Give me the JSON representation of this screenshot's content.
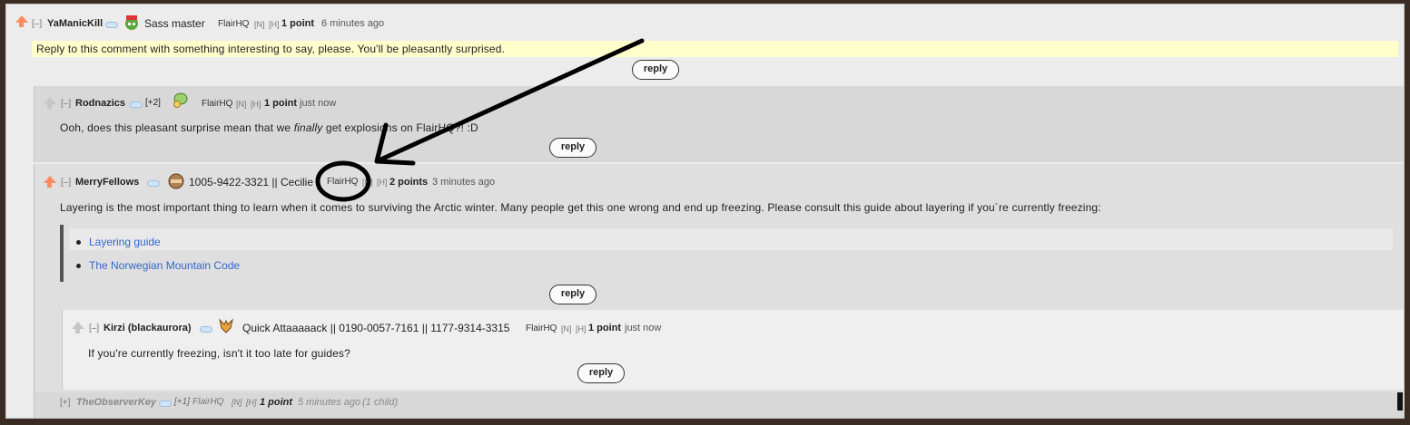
{
  "comments": {
    "c1": {
      "collapse": "[–]",
      "author": "YaManicKill",
      "flair": "Sass master",
      "tag": "FlairHQ",
      "mark_n": "[N]",
      "mark_h": "[H]",
      "points": "1 point",
      "time": "6 minutes ago",
      "body": "Reply to this comment with something interesting to say, please. You'll be pleasantly surprised.",
      "reply": "reply"
    },
    "c2": {
      "collapse": "[–]",
      "author": "Rodnazics",
      "karma": "[+2]",
      "tag": "FlairHQ",
      "mark_n": "[N]",
      "mark_h": "[H]",
      "points": "1 point",
      "time": "just now",
      "body_pre": "Ooh, does this pleasant surprise mean that we ",
      "body_em": "finally",
      "body_post": " get explosions on FlairHQ?! :D",
      "reply": "reply"
    },
    "c3": {
      "collapse": "[–]",
      "author": "MerryFellows",
      "flair": "1005-9422-3321 || Cecilie",
      "tag": "FlairHQ",
      "mark_n": "[N]",
      "mark_h": "[H]",
      "points": "2 points",
      "time": "3 minutes ago",
      "body": "Layering is the most important thing to learn when it comes to surviving the Arctic winter. Many people get this one wrong and end up freezing. Please consult this guide about layering if you´re currently freezing:",
      "links": [
        "Layering guide",
        "The Norwegian Mountain Code"
      ],
      "reply": "reply"
    },
    "c4": {
      "collapse": "[–]",
      "author": "Kirzi (blackaurora)",
      "flair": "Quick Attaaaaack || 0190-0057-7161 || 1177-9314-3315",
      "tag": "FlairHQ",
      "mark_n": "[N]",
      "mark_h": "[H]",
      "points": "1 point",
      "time": "just now",
      "body": "If you're currently freezing, isn't it too late for guides?",
      "reply": "reply"
    },
    "c5": {
      "collapse": "[+]",
      "author": "TheObserverKey",
      "karma": "[+1]",
      "tag": "FlairHQ",
      "mark_n": "[N]",
      "mark_h": "[H]",
      "points": "1 point",
      "time": "5 minutes ago",
      "children": "(1 child)"
    }
  },
  "colors": {
    "upvote": "#ff8b60",
    "highlight": "#ffffcc",
    "link": "#3366cc",
    "annotation": "#000000"
  }
}
